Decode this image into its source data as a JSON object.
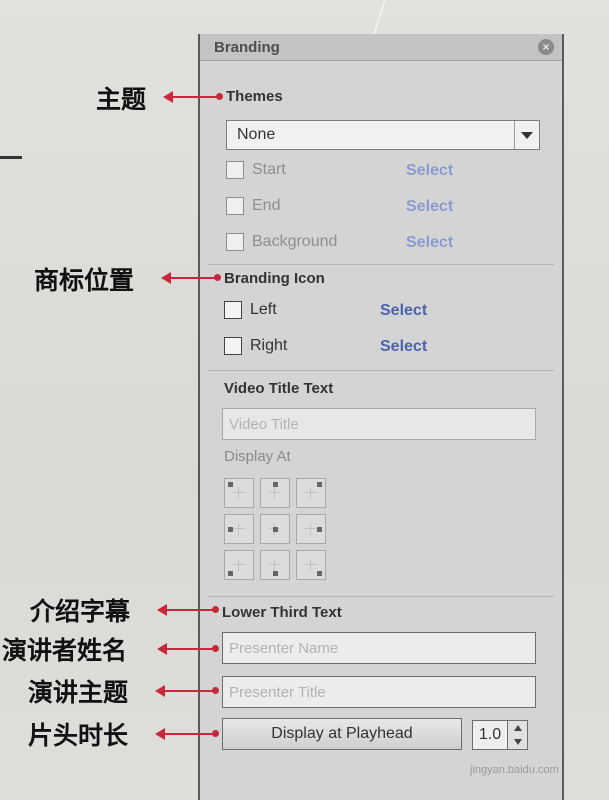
{
  "panel": {
    "title": "Branding",
    "themes": {
      "heading": "Themes",
      "dropdown_value": "None",
      "rows": [
        {
          "label": "Start",
          "action": "Select"
        },
        {
          "label": "End",
          "action": "Select"
        },
        {
          "label": "Background",
          "action": "Select"
        }
      ]
    },
    "branding_icon": {
      "heading": "Branding Icon",
      "rows": [
        {
          "label": "Left",
          "action": "Select"
        },
        {
          "label": "Right",
          "action": "Select"
        }
      ]
    },
    "video_title": {
      "heading": "Video Title Text",
      "placeholder": "Video Title",
      "display_at": "Display At"
    },
    "lower_third": {
      "heading": "Lower Third Text",
      "presenter_name_placeholder": "Presenter Name",
      "presenter_title_placeholder": "Presenter Title",
      "button_label": "Display at Playhead",
      "duration": "1.0"
    }
  },
  "callouts": {
    "themes": "主题",
    "branding_icon": "商标位置",
    "lower_third": "介绍字幕",
    "presenter_name": "演讲者姓名",
    "presenter_title": "演讲主题",
    "duration": "片头时长"
  },
  "colors": {
    "arrow": "#c8283c",
    "link_active": "#4d63ad",
    "link_disabled": "#8b9bd0"
  },
  "watermark": "jingyan.baidu.com"
}
